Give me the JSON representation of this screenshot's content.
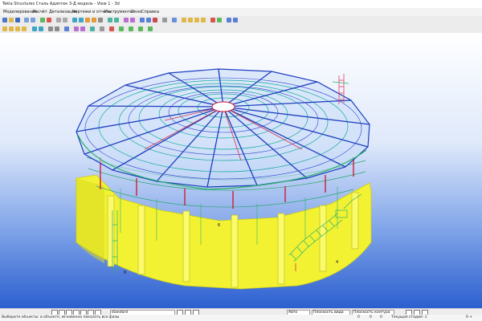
{
  "window": {
    "title": "Tekla Structures  Сталь Адиптек 3-Д модель - View 1 - 3d"
  },
  "menu": [
    "Моделирование",
    "Расчёт",
    "Детализация",
    "Чертежи и отчеты",
    "Инструменты",
    "Окно",
    "Справка"
  ],
  "colors": {
    "accent": "#2c5fd0",
    "model_walls": "#f3f321",
    "frame": "#1e3fbe",
    "bracing": "#12a8a0",
    "highlight": "#cc1c3c"
  },
  "viewport": {
    "markers": [
      "6",
      "4",
      "6"
    ]
  },
  "bottombar": {
    "profile_combo": "standard",
    "snap_mode": "Авто",
    "plane_1": "Плоскость вида",
    "plane_2": "Плоскость контура"
  },
  "status": {
    "message": "Выберите объекты: в объекте, мгновенно показать все фазы",
    "numbers": [
      "0",
      "0",
      "0"
    ],
    "phase": "Текущая стадия: 1",
    "sel": "0 +"
  }
}
